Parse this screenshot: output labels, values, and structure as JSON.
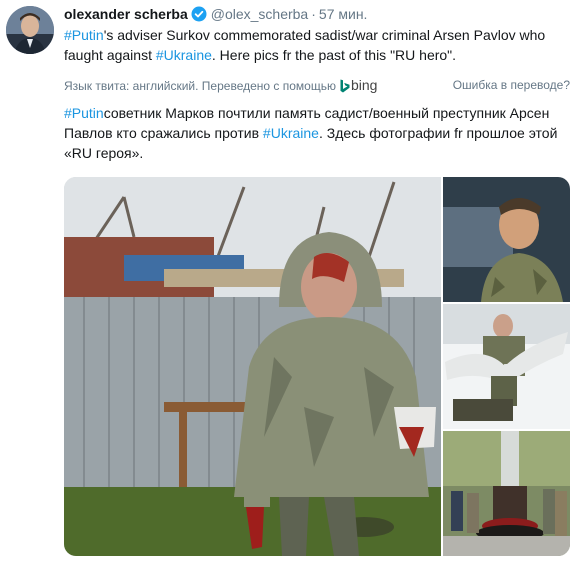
{
  "tweet": {
    "author_name": "olexander scherba",
    "author_handle": "@olex_scherba",
    "separator": "·",
    "time": "57 мин.",
    "text": [
      {
        "text": "#Putin",
        "hashtag": true
      },
      {
        "text": "'s adviser Surkov commemorated sadist/war criminal Arsen Pavlov who faught against ",
        "hashtag": false
      },
      {
        "text": "#Ukraine",
        "hashtag": true
      },
      {
        "text": ". Here pics fr the past of this \"RU hero\".",
        "hashtag": false
      }
    ],
    "translation": {
      "label": "Язык твита: английский. Переведено с помощью",
      "provider": "bing",
      "error_link": "Ошибка в переводе?",
      "text": [
        {
          "text": "#Putin",
          "hashtag": true
        },
        {
          "text": "советник Марков почтили память садист/военный преступник Арсен Павлов кто сражались против ",
          "hashtag": false
        },
        {
          "text": "#Ukraine",
          "hashtag": true
        },
        {
          "text": ". Здесь фотографии fr прошлое этой «RU героя».",
          "hashtag": false
        }
      ]
    }
  },
  "colors": {
    "link": "#1b95e0",
    "text": "#14171a",
    "muted": "#657786",
    "verified": "#1da1f2",
    "bing": "#008373"
  },
  "icons": {
    "verified": "verified-badge-icon",
    "bing": "bing-logo-icon"
  }
}
